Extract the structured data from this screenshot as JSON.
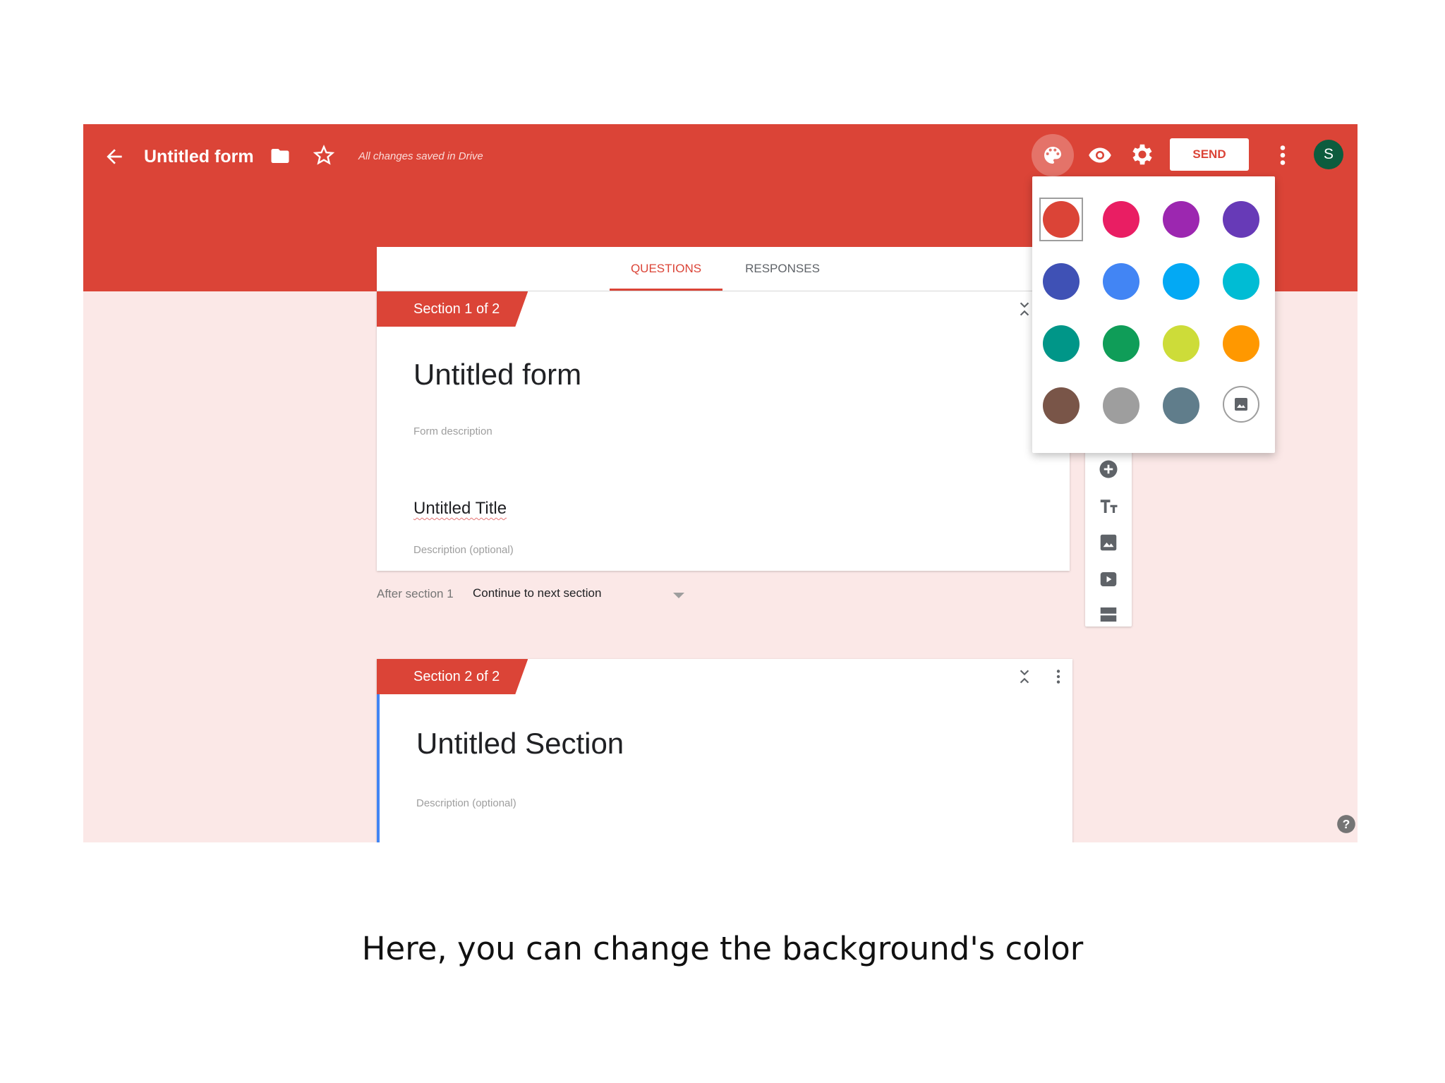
{
  "header": {
    "form_title": "Untitled form",
    "save_status": "All changes saved in Drive",
    "send_label": "SEND",
    "avatar_initial": "S",
    "icons": [
      "back-arrow-icon",
      "folder-icon",
      "star-icon",
      "palette-icon",
      "eye-icon",
      "gear-icon",
      "more-vert-icon"
    ]
  },
  "tabs": [
    {
      "label": "QUESTIONS",
      "active": true
    },
    {
      "label": "RESPONSES",
      "active": false
    }
  ],
  "sections": [
    {
      "tab_label": "Section 1 of 2",
      "title": "Untitled form",
      "description_placeholder": "Form description",
      "item_title": "Untitled Title",
      "item_description_placeholder": "Description (optional)"
    },
    {
      "tab_label": "Section 2 of 2",
      "title": "Untitled Section",
      "description_placeholder": "Description (optional)"
    }
  ],
  "after_section": {
    "label": "After section 1",
    "value": "Continue to next section"
  },
  "color_picker": {
    "selected": "#db4437",
    "swatches": [
      "#db4437",
      "#e91e63",
      "#9c27b0",
      "#673ab7",
      "#3f51b5",
      "#4285f4",
      "#03a9f4",
      "#00bcd4",
      "#009688",
      "#0f9d58",
      "#cddc39",
      "#ff9800",
      "#795548",
      "#9e9e9e",
      "#607d8b"
    ],
    "image_option_icon": "image-icon"
  },
  "side_toolbar": [
    "add-question-icon",
    "title-text-icon",
    "image-icon",
    "video-icon",
    "section-icon"
  ],
  "caption": "Here, you can change the background's color"
}
